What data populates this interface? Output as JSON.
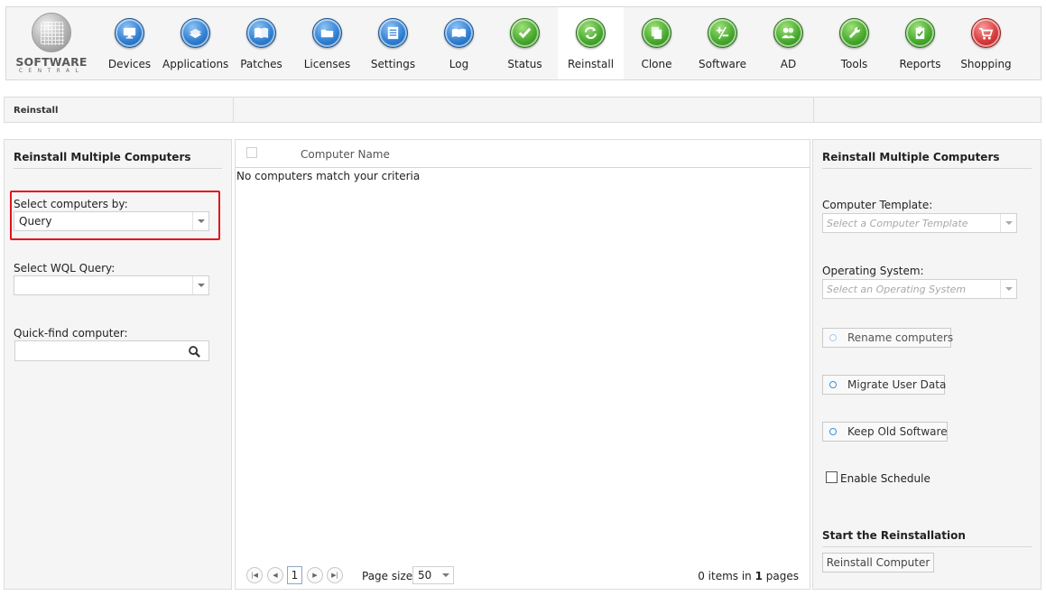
{
  "logo": {
    "word": "SOFTWARE",
    "sub": "CENTRAL"
  },
  "nav": [
    {
      "label": "Devices",
      "icon": "monitor-icon",
      "color": "blue"
    },
    {
      "label": "Applications",
      "icon": "applications-icon",
      "color": "blue"
    },
    {
      "label": "Patches",
      "icon": "book-icon",
      "color": "blue"
    },
    {
      "label": "Licenses",
      "icon": "folder-icon",
      "color": "blue"
    },
    {
      "label": "Settings",
      "icon": "settings-list-icon",
      "color": "blue"
    },
    {
      "label": "Log",
      "icon": "log-book-icon",
      "color": "blue"
    },
    {
      "label": "Status",
      "icon": "checkmark-icon",
      "color": "green"
    },
    {
      "label": "Reinstall",
      "icon": "refresh-icon",
      "color": "green",
      "active": true
    },
    {
      "label": "Clone",
      "icon": "copy-icon",
      "color": "green"
    },
    {
      "label": "Software",
      "icon": "plus-minus-icon",
      "color": "green"
    },
    {
      "label": "AD",
      "icon": "users-icon",
      "color": "green"
    },
    {
      "label": "Tools",
      "icon": "wrench-icon",
      "color": "green"
    },
    {
      "label": "Reports",
      "icon": "clipboard-icon",
      "color": "green"
    },
    {
      "label": "Shopping",
      "icon": "cart-icon",
      "color": "red"
    }
  ],
  "breadcrumb": {
    "current": "Reinstall"
  },
  "left": {
    "title": "Reinstall Multiple Computers",
    "select_by_label": "Select computers by:",
    "select_by_value": "Query",
    "wql_label": "Select WQL Query:",
    "wql_value": "",
    "quickfind_label": "Quick-find computer:",
    "quickfind_value": ""
  },
  "grid": {
    "column": "Computer Name",
    "empty_message": "No computers match your criteria",
    "pager": {
      "current_page": "1",
      "page_size_label": "Page size:",
      "page_size": "50",
      "items": "0",
      "items_text": " items in ",
      "pages": "1",
      "pages_text": " pages"
    }
  },
  "right": {
    "title": "Reinstall Multiple Computers",
    "template_label": "Computer Template:",
    "template_placeholder": "Select a Computer Template",
    "os_label": "Operating System:",
    "os_placeholder": "Select an Operating System",
    "rename_label": "Rename computers",
    "migrate_label": "Migrate User Data",
    "keep_label": "Keep Old Software",
    "schedule_label": "Enable Schedule",
    "start_title": "Start the Reinstallation",
    "start_button": "Reinstall Computer"
  },
  "colors": {
    "highlight": "#e3131b",
    "blue_icon": "#2f7fd2",
    "green_icon": "#46a92c",
    "red_icon": "#d83a3a"
  }
}
